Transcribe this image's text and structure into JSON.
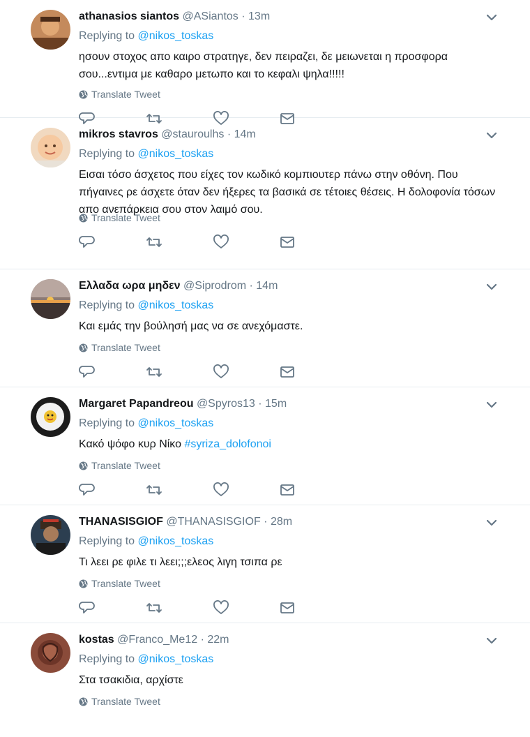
{
  "reply_prefix": "Replying to ",
  "reply_target": "@nikos_toskas",
  "translate_label": "Translate Tweet",
  "colors": {
    "link": "#1da1f2",
    "secondary": "#657786",
    "divider": "#e6ecf0"
  },
  "icons": {
    "reply": "reply-icon",
    "retweet": "retweet-icon",
    "like": "heart-icon",
    "dm": "envelope-icon",
    "caret": "chevron-down-icon",
    "translate": "globe-icon"
  },
  "tweets": [
    {
      "name": "athanasios siantos",
      "handle": "@ASiantos",
      "dot": "·",
      "time": "13m",
      "text": "ησουν στοχος απο καιρο στρατηγε, δεν πειραζει, δε μειωνεται η προσφορα σου...εντιμα με καθαρο μετωπο και το  κεφαλι ψηλα!!!!!"
    },
    {
      "name": "mikros stavros",
      "handle": "@stauroulhs",
      "dot": "·",
      "time": "14m",
      "text": "Εισαι τόσο άσχετος που είχες τον κωδικό κομπιουτερ πάνω στην οθόνη. Που πήγαινες ρε άσχετε όταν δεν ήξερες τα βασικά σε τέτοιες θέσεις. Η δολοφονία τόσων απο ανεπάρκεια σου στον λαιμό σου."
    },
    {
      "name": "Ελλαδα ωρα μηδεν",
      "handle": "@Siprodrom",
      "dot": "·",
      "time": "14m",
      "text": "Και εμάς την βούλησή μας να σε ανεχόμαστε."
    },
    {
      "name": "Margaret Papandreou",
      "handle": "@Spyros13",
      "dot": "·",
      "time": "15m",
      "text": "Κακό ψόφο κυρ Νίκο ",
      "hashtag": "#syriza_dolofonoi"
    },
    {
      "name": "THANASISGIOF",
      "handle": "@THANASISGIOF",
      "dot": "·",
      "time": "28m",
      "text": "Τι λεει ρε φιλε τι λεει;;;ελεος λιγη τσιπα ρε"
    },
    {
      "name": "kostas",
      "handle": "@Franco_Me12",
      "dot": "·",
      "time": "22m",
      "text": "Στα τσακιδια, αρχίστε"
    }
  ]
}
